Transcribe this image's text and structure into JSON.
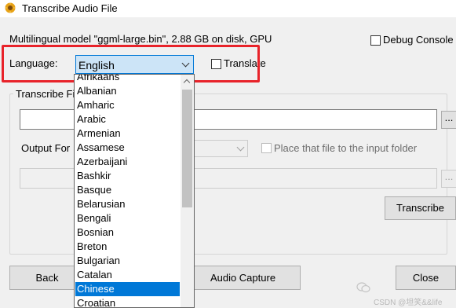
{
  "window": {
    "title": "Transcribe Audio File"
  },
  "model_info": "Multilingual model \"ggml-large.bin\", 2.88 GB on disk, GPU",
  "debug_console": {
    "label": "Debug Console",
    "checked": false
  },
  "language": {
    "label": "Language:",
    "selected": "English",
    "options": [
      "Afrikaans",
      "Albanian",
      "Amharic",
      "Arabic",
      "Armenian",
      "Assamese",
      "Azerbaijani",
      "Bashkir",
      "Basque",
      "Belarusian",
      "Bengali",
      "Bosnian",
      "Breton",
      "Bulgarian",
      "Catalan",
      "Chinese",
      "Croatian"
    ],
    "highlighted": "Chinese"
  },
  "translate": {
    "label": "Translate",
    "checked": false
  },
  "transcribe_group": {
    "label": "Transcribe Fi",
    "file_path": "",
    "browse_label": "...",
    "output_label": "Output For",
    "place_in_input_folder": {
      "label": "Place that file to the input folder",
      "checked": false,
      "enabled": false
    },
    "output_path": "",
    "output_browse_label": "...",
    "transcribe_button": "Transcribe"
  },
  "buttons": {
    "back": "Back",
    "audio_capture": "Audio Capture",
    "close": "Close"
  },
  "watermark": "CSDN @坦笑&&life",
  "colors": {
    "accent": "#0078d7",
    "highlight_box": "#e8232a",
    "select_bg": "#cce4f7"
  }
}
